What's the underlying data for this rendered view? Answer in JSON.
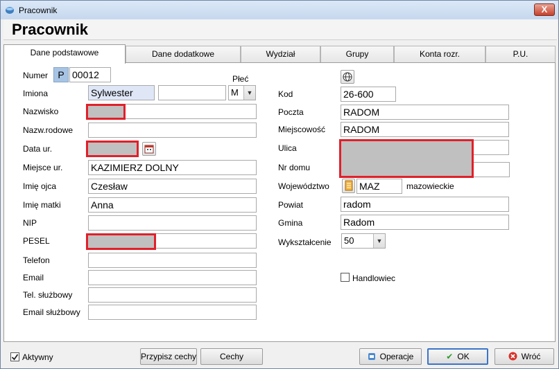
{
  "window": {
    "title": "Pracownik",
    "close_label": "X"
  },
  "header": {
    "page_title": "Pracownik"
  },
  "tabs": [
    {
      "label": "Dane podstawowe"
    },
    {
      "label": "Dane dodatkowe"
    },
    {
      "label": "Wydział"
    },
    {
      "label": "Grupy"
    },
    {
      "label": "Konta rozr."
    },
    {
      "label": "P.U."
    }
  ],
  "left": {
    "numer_label": "Numer",
    "numer_prefix": "P",
    "numer_value": "00012",
    "plec_label": "Płeć",
    "imiona_label": "Imiona",
    "imiona_value": "Sylwester",
    "imiona2_value": "",
    "plec_value": "M",
    "nazwisko_label": "Nazwisko",
    "nazw_rodowe_label": "Nazw.rodowe",
    "nazw_rodowe_value": "",
    "data_ur_label": "Data ur.",
    "miejsce_ur_label": "Miejsce ur.",
    "miejsce_ur_value": "KAZIMIERZ DOLNY",
    "imie_ojca_label": "Imię ojca",
    "imie_ojca_value": "Czesław",
    "imie_matki_label": "Imię matki",
    "imie_matki_value": "Anna",
    "nip_label": "NIP",
    "nip_value": "",
    "pesel_label": "PESEL",
    "telefon_label": "Telefon",
    "telefon_value": "",
    "email_label": "Email",
    "email_value": "",
    "tel_sluzbowy_label": "Tel. służbowy",
    "tel_sluzbowy_value": "",
    "email_sluzbowy_label": "Email służbowy",
    "email_sluzbowy_value": ""
  },
  "right": {
    "kod_label": "Kod",
    "kod_value": "26-600",
    "poczta_label": "Poczta",
    "poczta_value": "RADOM",
    "miejscowosc_label": "Miejscowość",
    "miejscowosc_value": "RADOM",
    "ulica_label": "Ulica",
    "nr_domu_label": "Nr domu",
    "wojewodztwo_label": "Województwo",
    "wojewodztwo_code": "MAZ",
    "wojewodztwo_name": "mazowieckie",
    "powiat_label": "Powiat",
    "powiat_value": "radom",
    "gmina_label": "Gmina",
    "gmina_value": "Radom",
    "wyksztalcenie_label": "Wykształcenie",
    "wyksztalcenie_value": "50",
    "handlowiec_label": "Handlowiec"
  },
  "footer": {
    "aktywny_label": "Aktywny",
    "przypisz_cechy_label": "Przypisz cechy",
    "cechy_label": "Cechy",
    "operacje_label": "Operacje",
    "ok_label": "OK",
    "wroc_label": "Wróć"
  },
  "icons": {
    "globe": "globe-icon",
    "calendar": "calendar-icon",
    "lookup": "lookup-icon",
    "check": "check-icon",
    "cancel": "cancel-icon"
  },
  "colors": {
    "titlebar": "#c6d8ee",
    "redaction_border": "#e0202a",
    "redaction_fill": "#c0c0c0",
    "highlight_field": "#dfe7f7"
  }
}
